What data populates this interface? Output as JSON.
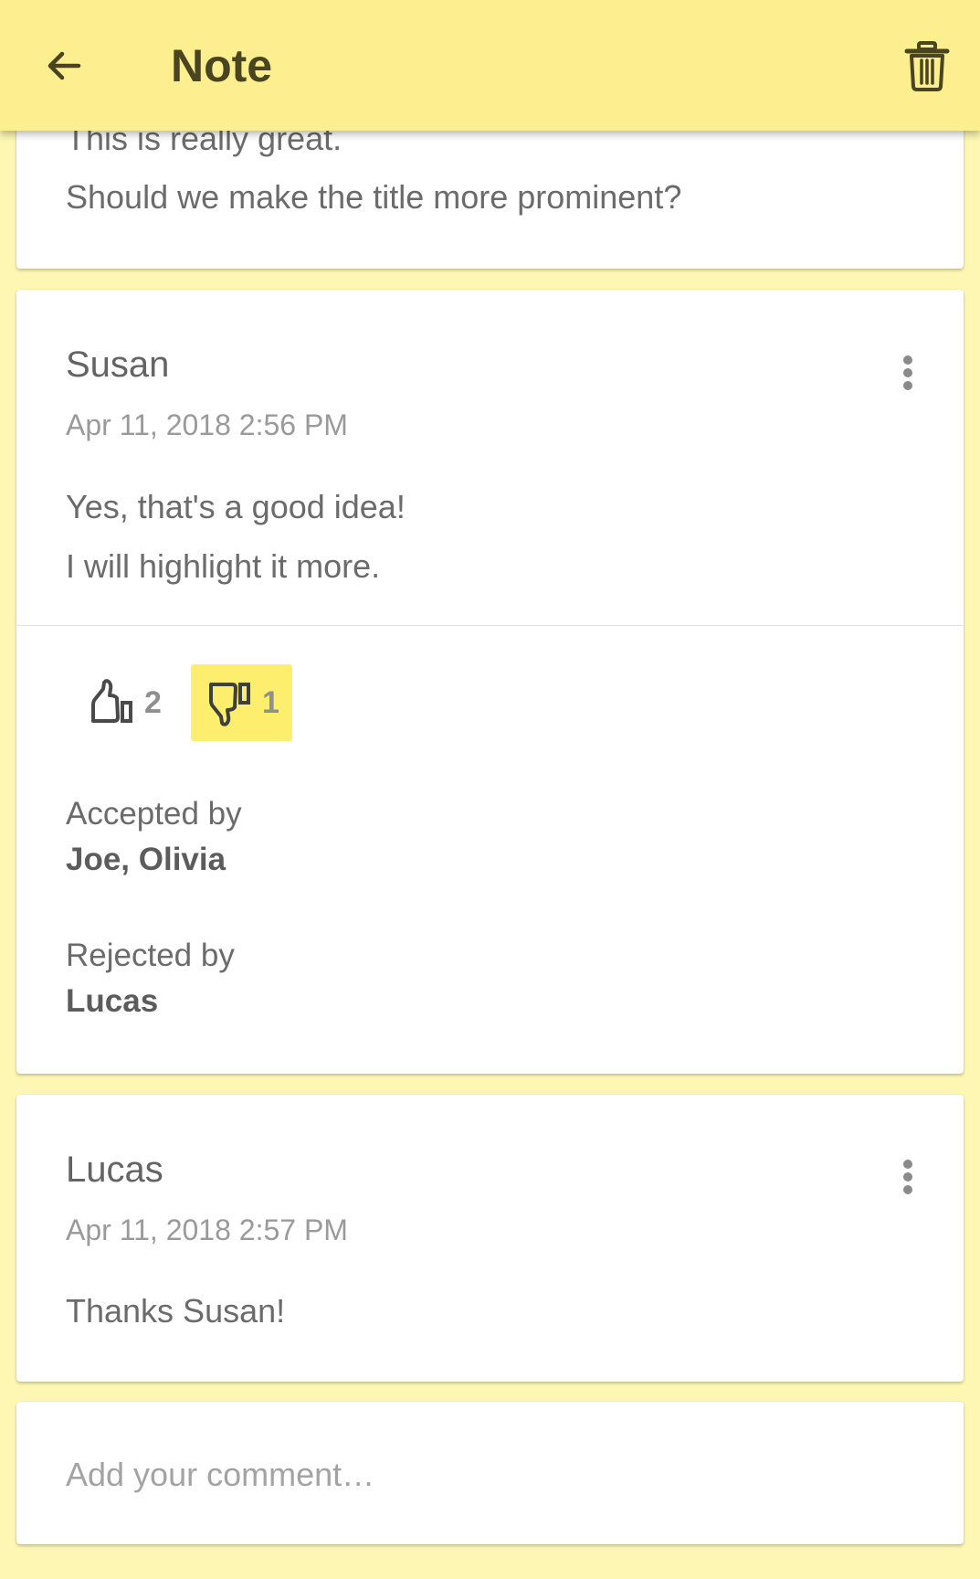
{
  "appbar": {
    "title": "Note",
    "back_icon": "arrow-left-icon",
    "delete_icon": "trash-icon"
  },
  "note": {
    "lines": [
      "This is really great.",
      "Should we make the title more prominent?"
    ]
  },
  "comments": [
    {
      "author": "Susan",
      "timestamp": "Apr 11, 2018 2:56 PM",
      "lines": [
        "Yes, that's a good idea!",
        "I will highlight it more."
      ],
      "likes": "2",
      "dislikes": "1",
      "dislike_selected": true,
      "accepted_label": "Accepted by",
      "accepted_names": "Joe, Olivia",
      "rejected_label": "Rejected by",
      "rejected_names": "Lucas"
    },
    {
      "author": "Lucas",
      "timestamp": "Apr 11, 2018 2:57 PM",
      "lines": [
        "Thanks Susan!"
      ]
    }
  ],
  "compose": {
    "placeholder": "Add your comment…"
  },
  "colors": {
    "appbar": "#fdee8f",
    "background": "#fdf7b3",
    "active_vote": "#fdee6e",
    "title": "#494520"
  }
}
